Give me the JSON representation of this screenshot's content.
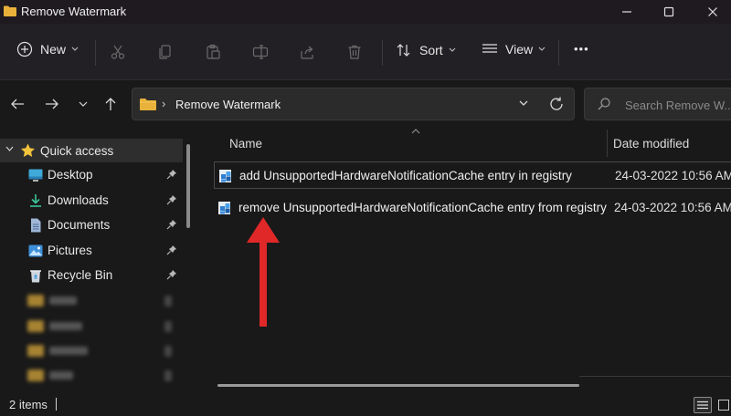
{
  "window": {
    "title": "Remove Watermark"
  },
  "toolbar": {
    "new_label": "New",
    "sort_label": "Sort",
    "view_label": "View",
    "more_label": "•••"
  },
  "address": {
    "separator": "›",
    "path": "Remove Watermark"
  },
  "search": {
    "placeholder": "Search Remove W..."
  },
  "sidebar": {
    "quick_access_label": "Quick access",
    "items": [
      {
        "label": "Desktop",
        "icon": "desktop-icon"
      },
      {
        "label": "Downloads",
        "icon": "downloads-icon"
      },
      {
        "label": "Documents",
        "icon": "documents-icon"
      },
      {
        "label": "Pictures",
        "icon": "pictures-icon"
      },
      {
        "label": "Recycle Bin",
        "icon": "recycle-bin-icon"
      }
    ]
  },
  "columns": {
    "name": "Name",
    "date_modified": "Date modified"
  },
  "files": [
    {
      "name": "add UnsupportedHardwareNotificationCache entry in registry",
      "date": "24-03-2022 10:56 AM",
      "icon": "registry-file-icon"
    },
    {
      "name": "remove UnsupportedHardwareNotificationCache entry from registry",
      "date": "24-03-2022 10:56 AM",
      "icon": "registry-file-icon"
    }
  ],
  "status": {
    "item_count": "2 items"
  },
  "colors": {
    "folder": "#e8b23a",
    "accent_arrow": "#e02828",
    "background": "#191919"
  }
}
